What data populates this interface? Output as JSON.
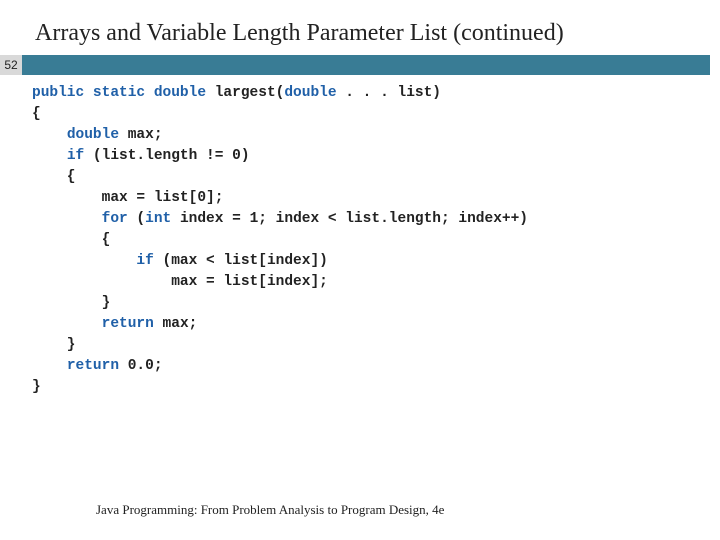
{
  "title": "Arrays and Variable Length Parameter List (continued)",
  "slide_number": "52",
  "footer": "Java Programming: From Problem Analysis to Program Design, 4e",
  "code": {
    "l1a": "public static double",
    "l1b": " largest(",
    "l1c": "double",
    "l1d": " . . . list)",
    "l2": "{",
    "l3a": "    ",
    "l3b": "double",
    "l3c": " max;",
    "l4": "",
    "l5a": "    ",
    "l5b": "if",
    "l5c": " (list.length != 0)",
    "l6": "    {",
    "l7": "        max = list[0];",
    "l8": "",
    "l9a": "        ",
    "l9b": "for",
    "l9c": " (",
    "l9d": "int",
    "l9e": " index = 1; index < list.length; index++)",
    "l10": "        {",
    "l11a": "            ",
    "l11b": "if",
    "l11c": " (max < list[index])",
    "l12": "                max = list[index];",
    "l13": "        }",
    "l14": "",
    "l15a": "        ",
    "l15b": "return",
    "l15c": " max;",
    "l16": "    }",
    "l17": "",
    "l18a": "    ",
    "l18b": "return",
    "l18c": " 0.0;",
    "l19": "}"
  }
}
